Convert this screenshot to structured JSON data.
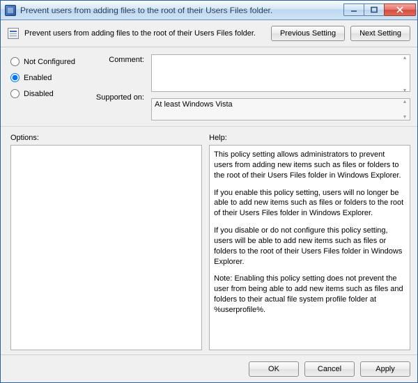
{
  "window": {
    "title": "Prevent users from adding files to the root of their Users Files folder."
  },
  "header": {
    "text": "Prevent users from adding files to the root of their Users Files folder.",
    "prev_button": "Previous Setting",
    "next_button": "Next Setting"
  },
  "config": {
    "radio_not_configured": "Not Configured",
    "radio_enabled": "Enabled",
    "radio_disabled": "Disabled",
    "selected": "Enabled",
    "comment_label": "Comment:",
    "comment_value": "",
    "supported_label": "Supported on:",
    "supported_value": "At least Windows Vista"
  },
  "panes": {
    "options_label": "Options:",
    "help_label": "Help:",
    "help_paragraphs": [
      "This policy setting allows administrators to prevent users from adding new items such as files or folders to the root of their Users Files folder in Windows Explorer.",
      "If you enable this policy setting, users will no longer be able to add new items such as files or folders to the root of their Users Files folder in Windows Explorer.",
      "If you disable or do not configure this policy setting, users will be able to add new items such as files or folders to the root of their Users Files folder in Windows Explorer.",
      "Note: Enabling this policy setting does not prevent the user from being able to add new items such as files and folders to their actual file system profile folder at %userprofile%."
    ]
  },
  "footer": {
    "ok": "OK",
    "cancel": "Cancel",
    "apply": "Apply"
  }
}
